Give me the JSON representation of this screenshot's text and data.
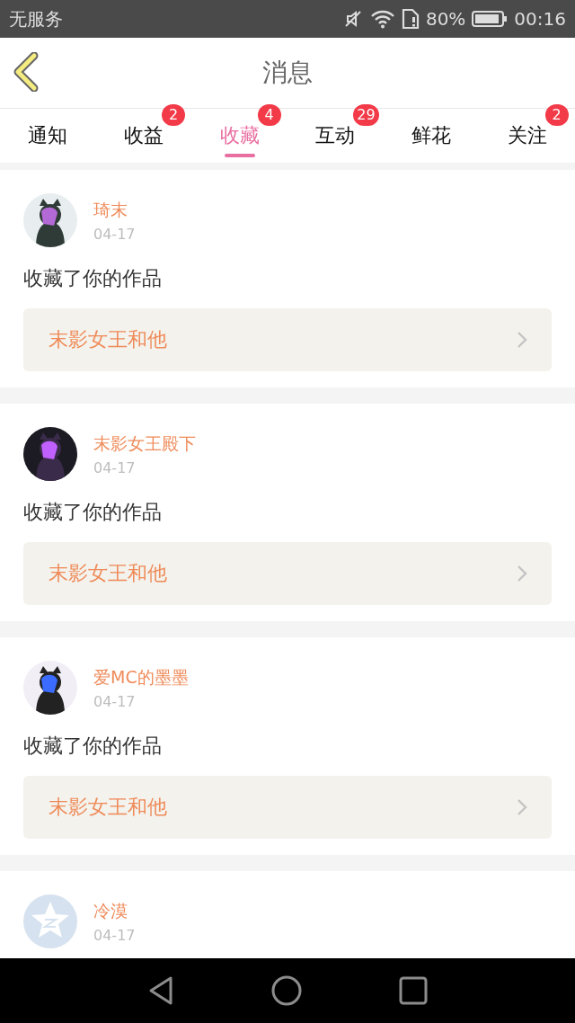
{
  "status_bar": {
    "carrier": "无服务",
    "battery": "80%",
    "time": "00:16"
  },
  "header": {
    "title": "消息"
  },
  "tabs": [
    {
      "label": "通知",
      "selected": false
    },
    {
      "label": "收益",
      "selected": false,
      "badge": "2"
    },
    {
      "label": "收藏",
      "selected": true,
      "badge": "4"
    },
    {
      "label": "互动",
      "selected": false,
      "badge": "29"
    },
    {
      "label": "鲜花",
      "selected": false
    },
    {
      "label": "关注",
      "selected": false,
      "badge": "2"
    }
  ],
  "messages": [
    {
      "kind": "picture",
      "name": "琦末",
      "date": "04-17",
      "text": "收藏了你的作品",
      "work": "末影女王和他"
    },
    {
      "kind": "picture",
      "name": "末影女王殿下",
      "date": "04-17",
      "text": "收藏了你的作品",
      "work": "末影女王和他"
    },
    {
      "kind": "picture",
      "name": "爱MC的墨墨",
      "date": "04-17",
      "text": "收藏了你的作品",
      "work": "末影女王和他"
    },
    {
      "kind": "default",
      "name": "冷漠",
      "date": "04-17"
    }
  ]
}
